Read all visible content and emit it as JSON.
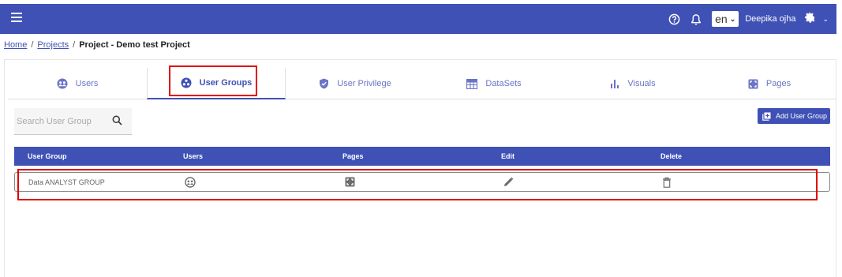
{
  "header": {
    "language": "en",
    "user_name": "Deepika ojha",
    "icons": [
      "menu-icon",
      "help-icon",
      "bell-icon",
      "gear-icon"
    ]
  },
  "breadcrumb": {
    "home": "Home",
    "projects": "Projects",
    "current": "Project - Demo test Project",
    "separator": "/"
  },
  "tabs": [
    {
      "label": "Users",
      "icon": "users-icon",
      "active": false
    },
    {
      "label": "User Groups",
      "icon": "user-groups-icon",
      "active": true
    },
    {
      "label": "User Privilege",
      "icon": "shield-icon",
      "active": false
    },
    {
      "label": "DataSets",
      "icon": "dataset-icon",
      "active": false
    },
    {
      "label": "Visuals",
      "icon": "bar-chart-icon",
      "active": false
    },
    {
      "label": "Pages",
      "icon": "pages-icon",
      "active": false
    }
  ],
  "search": {
    "placeholder": "Search User Group",
    "value": ""
  },
  "add_button": {
    "label": "Add User Group"
  },
  "table": {
    "columns": [
      "User Group",
      "Users",
      "Pages",
      "Edit",
      "Delete"
    ],
    "rows": [
      {
        "user_group": "Data ANALYST GROUP",
        "users_icon": "users-icon",
        "pages_icon": "pages-icon",
        "edit_icon": "pencil-icon",
        "delete_icon": "trash-icon"
      }
    ]
  },
  "colors": {
    "primary": "#3f51b5",
    "highlight": "#e00000"
  }
}
